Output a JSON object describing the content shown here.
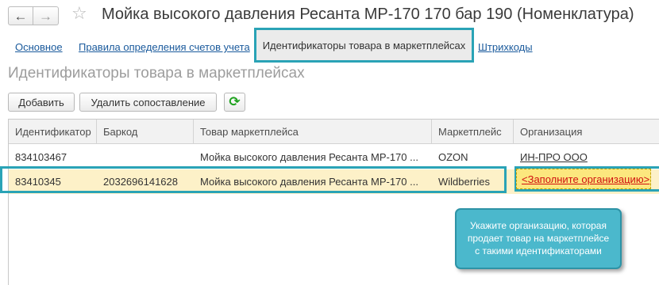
{
  "window": {
    "title": "Мойка высокого давления Ресанта МР-170 170 бар 190 (Номенклатура)",
    "back_icon": "arrow-left-icon",
    "forward_icon": "arrow-right-icon",
    "favorite_icon": "star-icon"
  },
  "tabs": [
    {
      "label": "Основное",
      "active": false
    },
    {
      "label": "Правила определения счетов учета",
      "active": false
    },
    {
      "label": "Идентификаторы товара в маркетплейсах",
      "active": true
    },
    {
      "label": "Штрихкоды",
      "active": false
    }
  ],
  "section_title": "Идентификаторы товара в маркетплейсах",
  "toolbar": {
    "add_label": "Добавить",
    "unlink_label": "Удалить сопоставление",
    "refresh_icon": "refresh-icon"
  },
  "table": {
    "columns": [
      "Идентификатор",
      "Баркод",
      "Товар маркетплейса",
      "Маркетплейс",
      "Организация"
    ],
    "rows": [
      {
        "id": "834103467",
        "barcode": "",
        "product": "Мойка высокого давления Ресанта МР-170 ...",
        "marketplace": "OZON",
        "organization": "ИН-ПРО ООО"
      },
      {
        "id": "83410345",
        "barcode": "2032696141628",
        "product": "Мойка высокого давления Ресанта МР-170 ...",
        "marketplace": "Wildberries",
        "organization": "<Заполните организацию>"
      }
    ]
  },
  "callout": {
    "line1": "Укажите организацию, которая",
    "line2": "продает товар на маркетплейсе",
    "line3": "с такими идентификаторами"
  },
  "colors": {
    "accent": "#2aa3b6",
    "callout_bg": "#4bb8cc",
    "highlight_row": "#fdf1c8",
    "warning_fill": "#fce77e",
    "warning_text": "#d01010"
  }
}
